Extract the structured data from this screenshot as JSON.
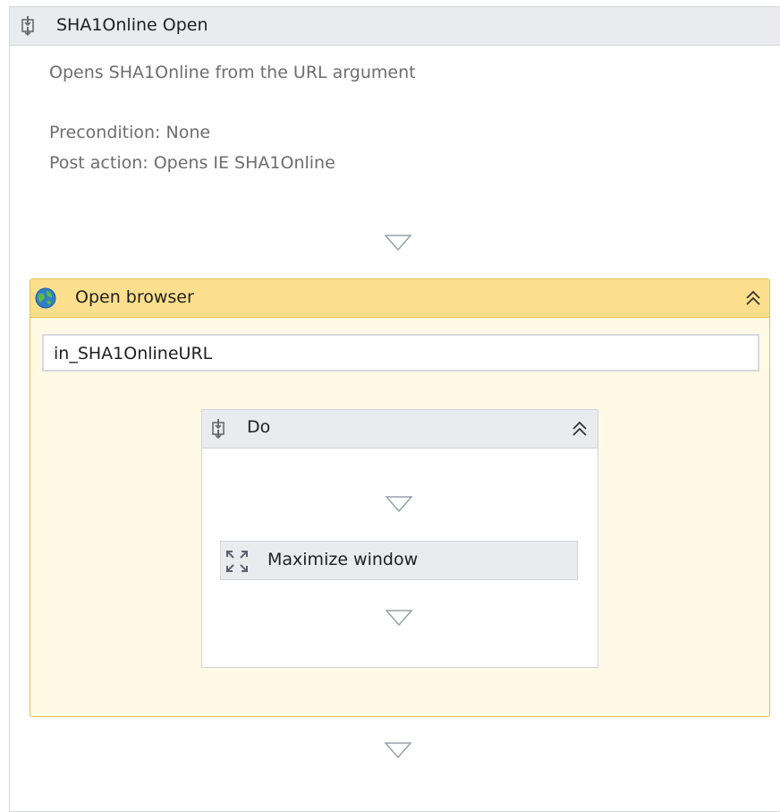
{
  "sequence": {
    "title": "SHA1Online Open",
    "icon": "sequence-icon",
    "annotation": {
      "description": "Opens SHA1Online from the URL argument",
      "precondition": "Precondition: None",
      "post_action": "Post action: Opens IE SHA1Online"
    }
  },
  "open_browser": {
    "title": "Open browser",
    "icon": "globe-icon",
    "collapse_icon": "double-chevron-up-icon",
    "url_value": "in_SHA1OnlineURL",
    "do": {
      "title": "Do",
      "icon": "sequence-icon",
      "collapse_icon": "double-chevron-up-icon",
      "activities": [
        {
          "title": "Maximize window",
          "icon": "maximize-icon"
        }
      ]
    }
  },
  "colors": {
    "header_gray": "#e9ebee",
    "browser_header": "#fbdf8c",
    "browser_body": "#fff9e6",
    "browser_border": "#e7c045",
    "annotation_text": "#6d6d6d"
  }
}
